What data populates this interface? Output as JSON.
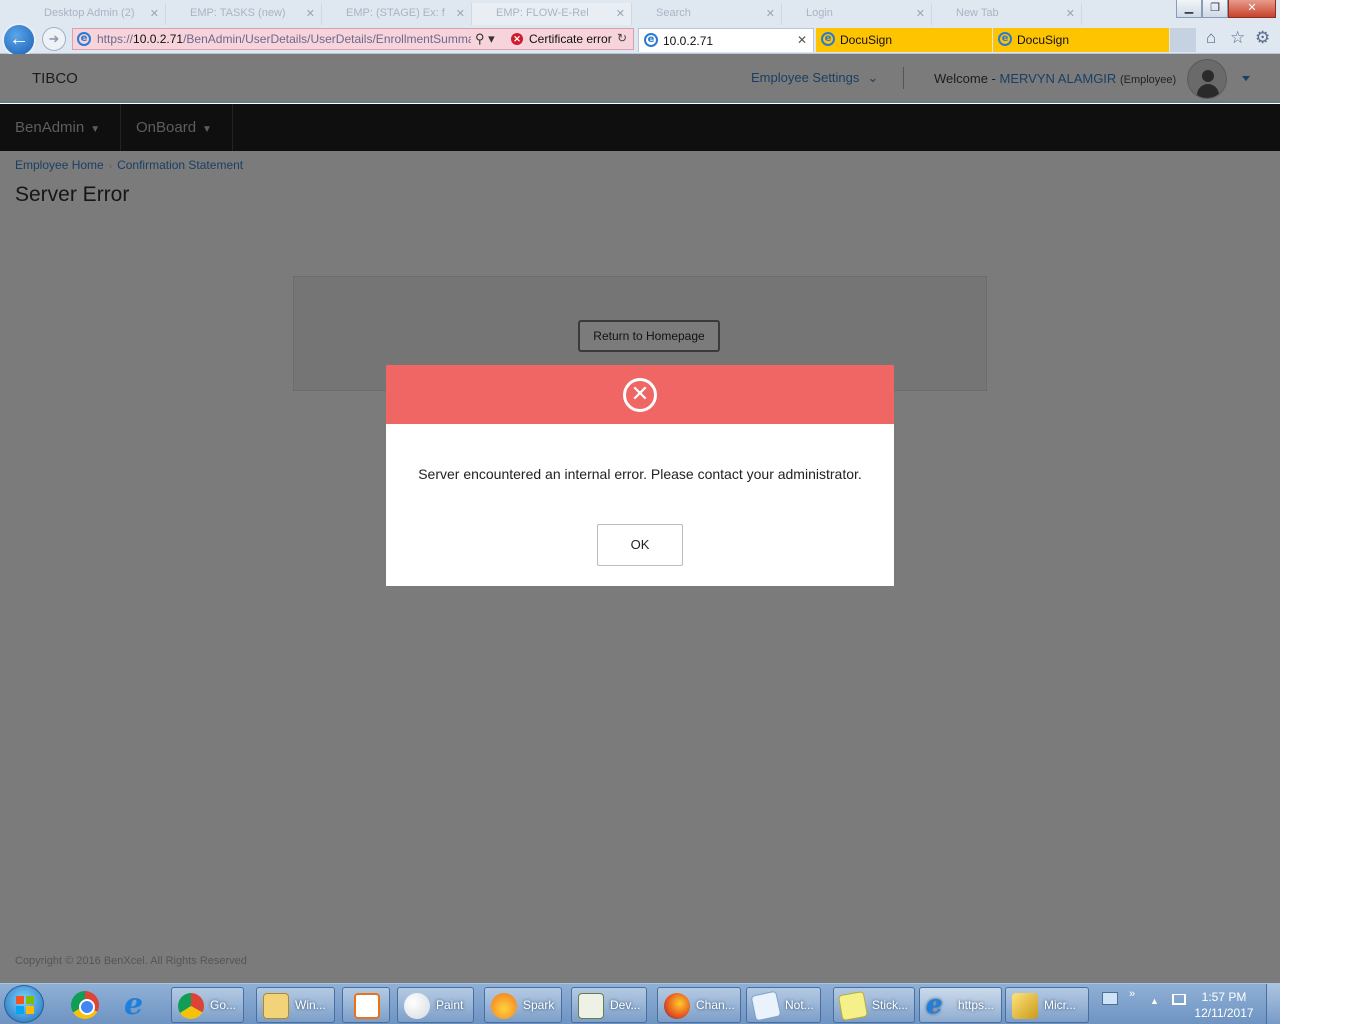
{
  "browser": {
    "faded_tabs": [
      "Desktop Admin (2)",
      "EMP: TASKS (new)",
      "EMP: (STAGE) Ex: f",
      "EMP: FLOW-E-Rel",
      "Search",
      "Login",
      "New Tab"
    ],
    "address": {
      "url_prefix": "https://",
      "url_host": "10.0.2.71",
      "url_path": "/BenAdmin/UserDetails/UserDetails/EnrollmentSumma",
      "cert_error": "Certificate error"
    },
    "tabs": [
      {
        "label": "10.0.2.71",
        "active": true
      },
      {
        "label": "DocuSign"
      },
      {
        "label": "DocuSign"
      }
    ],
    "colors": {
      "docusign_tab": "#ffc400",
      "cert_error_bg": "#f7d3dc"
    }
  },
  "header": {
    "brand": "TIBCO",
    "employee_settings": "Employee Settings",
    "welcome_prefix": "Welcome -",
    "user_name": "MERVYN ALAMGIR",
    "user_role": "(Employee)"
  },
  "nav": {
    "items": [
      {
        "label": "BenAdmin"
      },
      {
        "label": "OnBoard"
      }
    ]
  },
  "main": {
    "breadcrumb": [
      "Employee Home",
      "Confirmation Statement"
    ],
    "page_title": "Server Error",
    "return_button": "Return to Homepage",
    "copyright": "Copyright © 2016 BenXcel. All Rights Reserved"
  },
  "modal": {
    "message": "Server encountered an internal error. Please contact your administrator.",
    "ok_label": "OK",
    "header_color": "#f06664",
    "icon": "circle-x-icon"
  },
  "taskbar": {
    "tasks": [
      "Go...",
      "Win...",
      "Paint",
      "Spark",
      "Dev...",
      "Chan...",
      "Not...",
      "Stick...",
      "https...",
      "Micr..."
    ],
    "clock_time": "1:57 PM",
    "clock_date": "12/11/2017"
  }
}
